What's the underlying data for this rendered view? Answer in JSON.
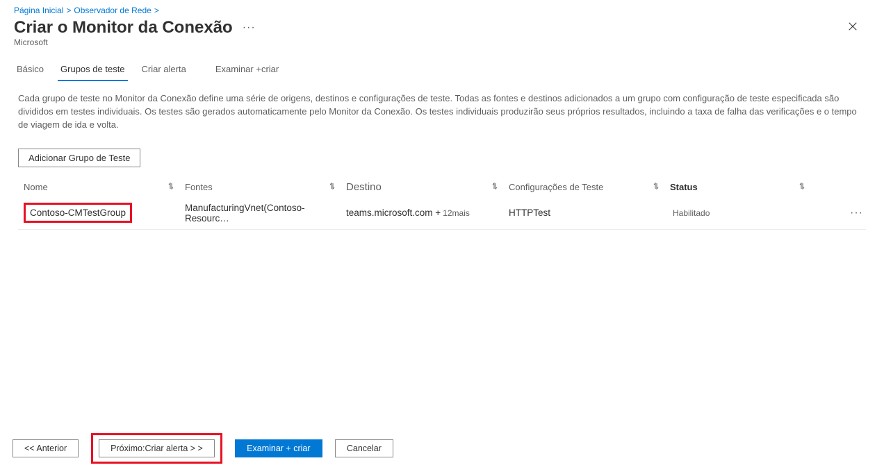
{
  "breadcrumb": {
    "home": "Página Inicial",
    "watcher": "Observador de Rede"
  },
  "header": {
    "title": "Criar o Monitor da Conexão",
    "subtitle": "Microsoft"
  },
  "tabs": {
    "basic": "Básico",
    "groups": "Grupos de teste",
    "alert": "Criar alerta",
    "review_prefix": "Examinar +",
    "review_suffix": "criar"
  },
  "description": "Cada grupo de teste no Monitor da Conexão define uma série de origens, destinos e configurações de teste. Todas as fontes e destinos adicionados a um grupo com configuração de teste especificada são divididos em testes individuais. Os testes são gerados automaticamente pelo Monitor da Conexão. Os testes individuais produzirão seus próprios resultados, incluindo a taxa de falha das verificações e o tempo de viagem de ida e volta.",
  "buttons": {
    "add_group": "Adicionar Grupo de Teste"
  },
  "table": {
    "headers": {
      "name": "Nome",
      "fontes": "Fontes",
      "dest": "Destino",
      "config": "Configurações de Teste",
      "status": "Status"
    },
    "rows": [
      {
        "name": "Contoso-CMTestGroup",
        "fontes": "ManufacturingVnet(Contoso-Resourc…",
        "dest_main": "teams.microsoft.com +",
        "dest_more": "12mais",
        "config": "HTTPTest",
        "status": "Habilitado"
      }
    ]
  },
  "footer": {
    "prev": "<<  Anterior",
    "next": "Próximo:Criar alerta >  >",
    "review": "Examinar + criar",
    "cancel": "Cancelar"
  }
}
